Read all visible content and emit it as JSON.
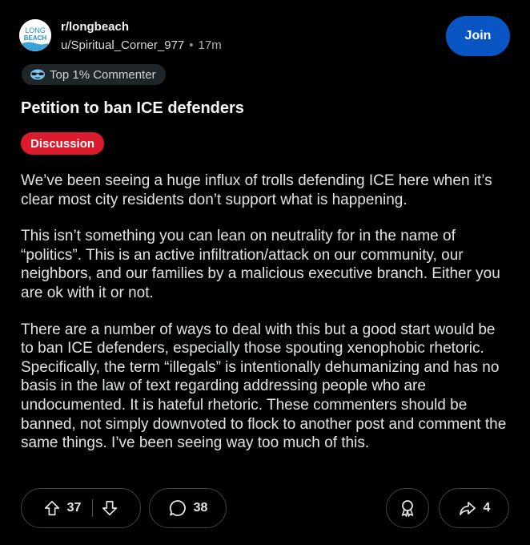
{
  "header": {
    "subreddit": "r/longbeach",
    "username": "u/Spiritual_Corner_977",
    "separator": "•",
    "time_ago": "17m",
    "join_label": "Join",
    "avatar_text_top": "LONG",
    "avatar_text_bottom": "BEACH"
  },
  "badge": {
    "label": "Top 1% Commenter",
    "icon": "sunglasses-icon"
  },
  "post": {
    "title": "Petition to ban ICE defenders",
    "flair": "Discussion",
    "paragraphs": [
      "We’ve been seeing a huge influx of trolls defending ICE here when it’s clear most city residents don’t support what is happening.",
      "This isn’t something you can lean on neutrality for in the name of “politics”. This is an active infiltration/attack on our community, our neighbors, and our families by a malicious executive branch. Either you are ok with it or not.",
      "There are a number of ways to deal with this but a good start would be to ban ICE defenders, especially those spouting xenophobic rhetoric. Specifically, the term “illegals” is intentionally dehumanizing and has no basis in the law of text regarding addressing people who are undocumented. It is hateful rhetoric. These commenters should be banned, not simply downvoted to flock to another post and comment the same things. I’ve been seeing way too much of this."
    ]
  },
  "actions": {
    "upvotes": "37",
    "comments": "38",
    "shares": "4"
  },
  "colors": {
    "background": "#000000",
    "join_button": "#0a55c4",
    "flair": "#dc1c2c"
  }
}
